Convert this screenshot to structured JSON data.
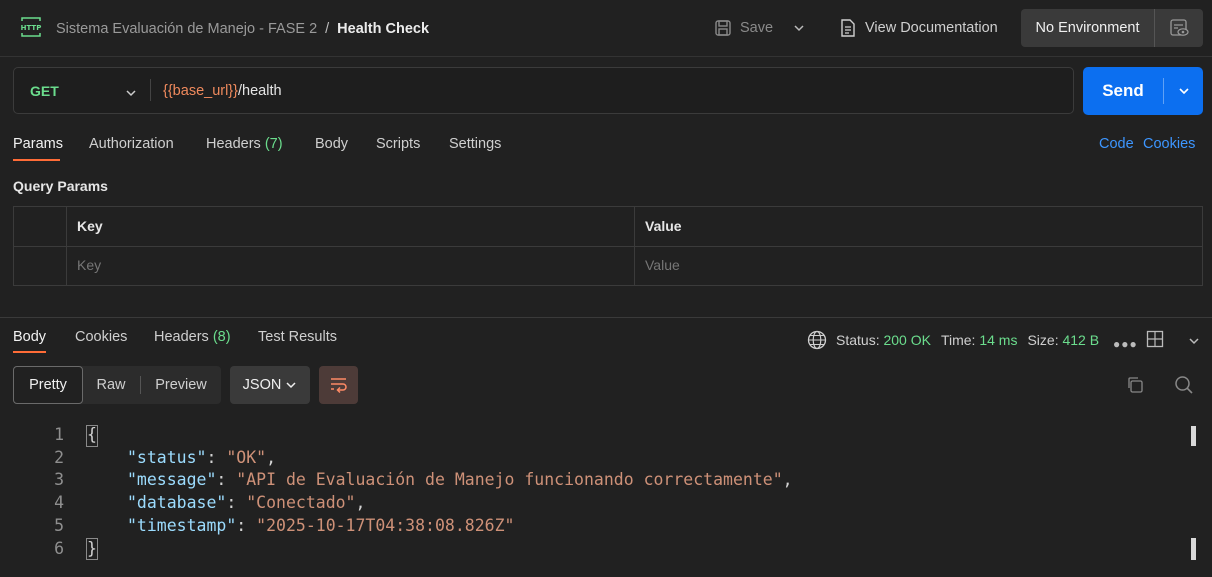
{
  "header": {
    "collection": "Sistema Evaluación de Manejo - FASE 2",
    "separator": "/",
    "request_name": "Health Check",
    "save_label": "Save",
    "docs_label": "View Documentation",
    "environment": "No Environment"
  },
  "request": {
    "method": "GET",
    "url_variable": "{{base_url}}",
    "url_path": "/health",
    "send_label": "Send",
    "tabs": [
      {
        "label": "Params"
      },
      {
        "label": "Authorization"
      },
      {
        "label": "Headers",
        "count": "(7)"
      },
      {
        "label": "Body"
      },
      {
        "label": "Scripts"
      },
      {
        "label": "Settings"
      }
    ],
    "links": {
      "code": "Code",
      "cookies": "Cookies"
    },
    "query_params_title": "Query Params",
    "table": {
      "key_header": "Key",
      "value_header": "Value",
      "key_placeholder": "Key",
      "value_placeholder": "Value"
    }
  },
  "response": {
    "tabs": [
      {
        "label": "Body"
      },
      {
        "label": "Cookies"
      },
      {
        "label": "Headers",
        "count": "(8)"
      },
      {
        "label": "Test Results"
      }
    ],
    "status_label": "Status:",
    "status_value": "200 OK",
    "time_label": "Time:",
    "time_value": "14 ms",
    "size_label": "Size:",
    "size_value": "412 B",
    "formats": {
      "pretty": "Pretty",
      "raw": "Raw",
      "preview": "Preview"
    },
    "language": "JSON",
    "line_numbers": [
      "1",
      "2",
      "3",
      "4",
      "5",
      "6"
    ],
    "body": {
      "open": "{",
      "close": "}",
      "lines": [
        {
          "key": "\"status\"",
          "value": "\"OK\"",
          "comma": ","
        },
        {
          "key": "\"message\"",
          "value": "\"API de Evaluación de Manejo funcionando correctamente\"",
          "comma": ","
        },
        {
          "key": "\"database\"",
          "value": "\"Conectado\"",
          "comma": ","
        },
        {
          "key": "\"timestamp\"",
          "value": "\"2025-10-17T04:38:08.826Z\"",
          "comma": ""
        }
      ]
    }
  },
  "colors": {
    "accent": "#ff6c37",
    "send": "#0c6ff0",
    "success": "#6bdd8d",
    "variable": "#f08a5d",
    "link": "#3d96ff"
  },
  "icons": [
    "http-icon",
    "save-icon",
    "chevron-down-icon",
    "document-icon",
    "environment-eye-icon",
    "globe-icon",
    "more-icon",
    "layout-icon",
    "wrap-icon",
    "copy-icon",
    "search-icon"
  ]
}
